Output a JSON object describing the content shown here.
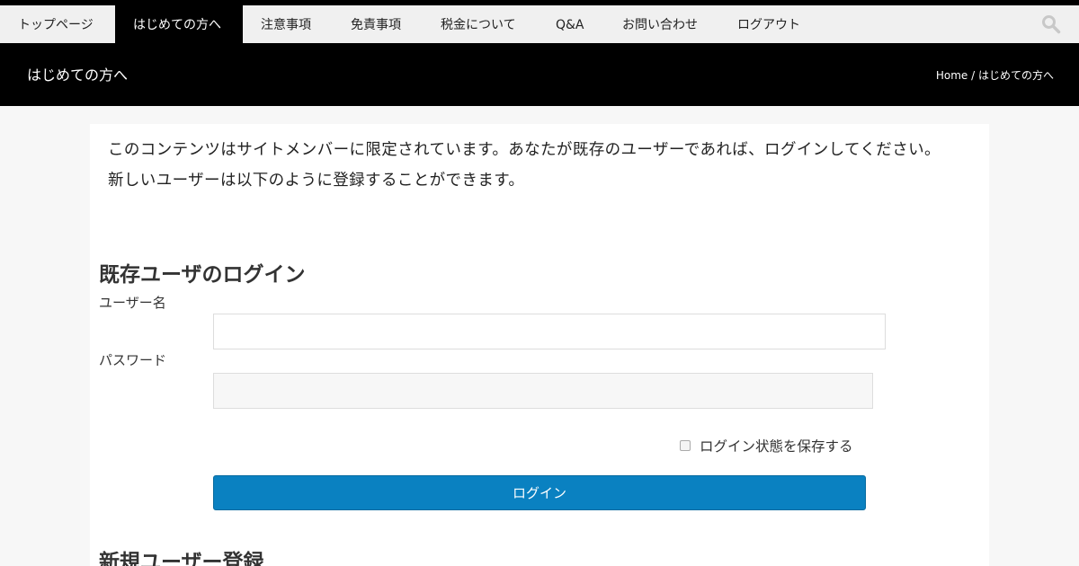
{
  "nav": {
    "items": [
      {
        "label": "トップページ",
        "active": false
      },
      {
        "label": "はじめての方へ",
        "active": true
      },
      {
        "label": "注意事項",
        "active": false
      },
      {
        "label": "免責事項",
        "active": false
      },
      {
        "label": "税金について",
        "active": false
      },
      {
        "label": "Q&A",
        "active": false
      },
      {
        "label": "お問い合わせ",
        "active": false
      },
      {
        "label": "ログアウト",
        "active": false
      }
    ],
    "search_icon": "search-icon"
  },
  "header": {
    "page_title": "はじめての方へ",
    "breadcrumb": "Home / はじめての方へ"
  },
  "main": {
    "notice_line1": "このコンテンツはサイトメンバーに限定されています。あなたが既存のユーザーであれば、ログインしてください。",
    "notice_line2": "新しいユーザーは以下のように登録することができます。",
    "login_section": {
      "title": "既存ユーザのログイン",
      "username_label": "ユーザー名",
      "username_value": "",
      "password_label": "パスワード",
      "password_value": "",
      "remember_label": "ログイン状態を保存する",
      "remember_checked": false,
      "submit_label": "ログイン"
    },
    "register_section": {
      "title": "新規ユーザー登録"
    }
  },
  "colors": {
    "nav_bg": "#f0f0f0",
    "nav_active_bg": "#000000",
    "header_bg": "#000000",
    "button_bg": "#0a81c1"
  }
}
